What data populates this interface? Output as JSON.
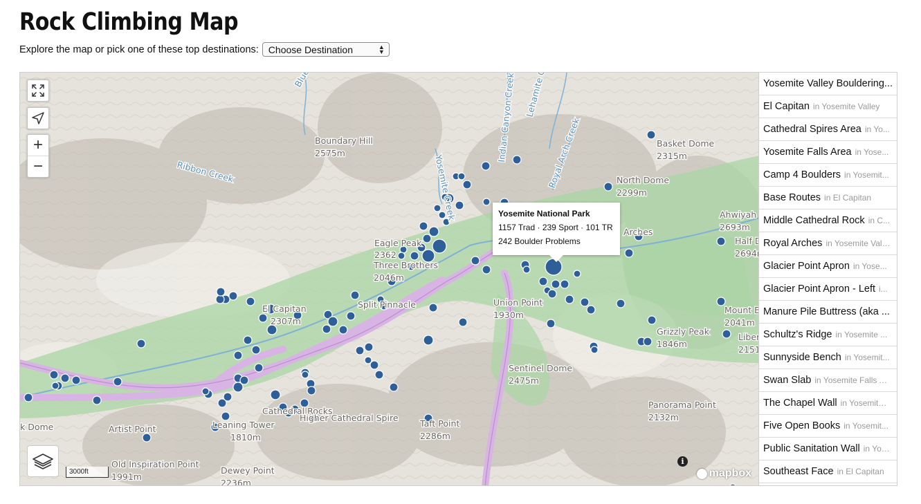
{
  "page": {
    "title": "Rock Climbing Map",
    "explore_text": "Explore the map or pick one of these top destinations:",
    "destination_select": {
      "selected": "Choose Destination"
    }
  },
  "map": {
    "controls": {
      "fullscreen_icon": "expand-icon",
      "locate_icon": "navigation-arrow-icon",
      "zoom_in": "+",
      "zoom_out": "−",
      "layers_icon": "layers-icon"
    },
    "scale_label": "3000ft",
    "attribution": {
      "logo_text": "mapbox",
      "info_label": "i"
    },
    "popup": {
      "title": "Yosemite National Park",
      "routes": "1157 Trad · 239 Sport · 101 TR",
      "boulders": "242 Boulder Problems"
    },
    "labels": [
      "Boundary Hill",
      "2575m",
      "Ribbon Creek",
      "Blue",
      "Yosemite Creek",
      "Indian Canyon Creek",
      "Lehamite Creek",
      "Royal Arch Creek",
      "Basket Dome",
      "2315m",
      "North Dome",
      "2299m",
      "Ahwiyah",
      "2693m",
      "Half D",
      "2694m",
      "Arches",
      "Eagle Peak",
      "2362",
      "Three Brothers",
      "2046m",
      "El Capitan",
      "2307m",
      "Split Pinnacle",
      "Union Point",
      "1930m",
      "Mount B",
      "2041m",
      "Grizzly Peak",
      "1846m",
      "Liber",
      "2151",
      "Sentinel Dome",
      "2475m",
      "Panorama Point",
      "2132m",
      "Cathedral Rocks",
      "Higher Cathedral Spire",
      "Leaning Tower",
      "1810m",
      "Taft Point",
      "2286m",
      "Artist Point",
      "Old Inspiration Point",
      "1991m",
      "Dewey Point",
      "2236m",
      "k Dome"
    ],
    "colors": {
      "terrain": "#e6e3dc",
      "park_green": "#a9d6a4",
      "road": "#d7b4e3",
      "marker": "#2f5f98",
      "water": "#7fb1d6"
    }
  },
  "destinations": [
    {
      "name": "Yosemite Valley Bouldering...",
      "location": ""
    },
    {
      "name": "El Capitan",
      "location": "in Yosemite Valley"
    },
    {
      "name": "Cathedral Spires Area",
      "location": "in Yo..."
    },
    {
      "name": "Yosemite Falls Area",
      "location": "in Yose..."
    },
    {
      "name": "Camp 4 Boulders",
      "location": "in Yosemit..."
    },
    {
      "name": "Base Routes",
      "location": "in El Capitan"
    },
    {
      "name": "Middle Cathedral Rock",
      "location": "in C..."
    },
    {
      "name": "Royal Arches",
      "location": "in Yosemite Valley"
    },
    {
      "name": "Glacier Point Apron",
      "location": "in Yose..."
    },
    {
      "name": "Glacier Point Apron - Left",
      "location": "i..."
    },
    {
      "name": "Manure Pile Buttress (aka ...",
      "location": ""
    },
    {
      "name": "Schultz's Ridge",
      "location": "in Yosemite ..."
    },
    {
      "name": "Sunnyside Bench",
      "location": "in Yosemit..."
    },
    {
      "name": "Swan Slab",
      "location": "in Yosemite Falls A..."
    },
    {
      "name": "The Chapel Wall",
      "location": "in Yosemite ..."
    },
    {
      "name": "Five Open Books",
      "location": "in Yosemit..."
    },
    {
      "name": "Public Sanitation Wall",
      "location": "in Yos..."
    },
    {
      "name": "Southeast Face",
      "location": "in El Capitan"
    }
  ]
}
